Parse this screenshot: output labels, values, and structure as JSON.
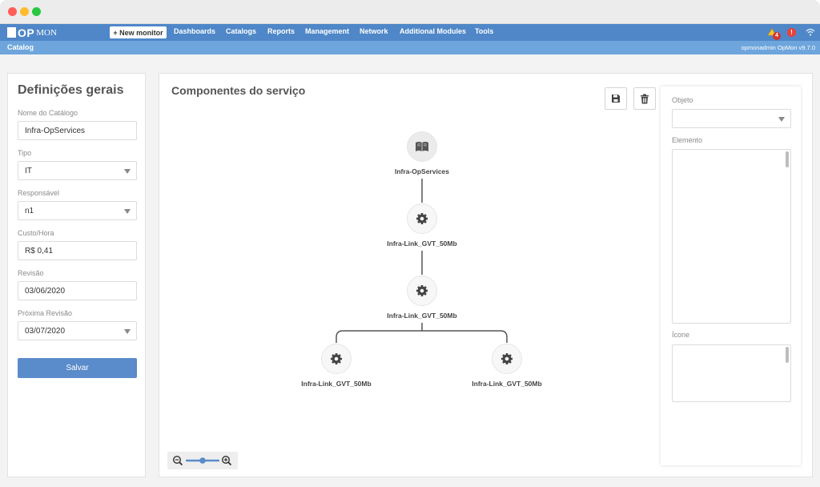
{
  "navbar": {
    "logo_op": "OP",
    "logo_mon": "MON",
    "new_monitor": "+ New monitor",
    "items": [
      "Dashboards",
      "Catalogs",
      "Reports",
      "Management",
      "Network",
      "Additional Modules",
      "Tools"
    ],
    "notification_count": "4"
  },
  "subbar": {
    "breadcrumb": "Catalog",
    "user_info": "opmonadmin  OpMon v9.7.0"
  },
  "left_panel": {
    "title": "Definições gerais",
    "fields": [
      {
        "label": "Nome do Catálogo",
        "value": "Infra-OpServices",
        "type": "text"
      },
      {
        "label": "Tipo",
        "value": "IT",
        "type": "select"
      },
      {
        "label": "Responsável",
        "value": "n1",
        "type": "select"
      },
      {
        "label": "Custo/Hora",
        "value": "R$ 0,41",
        "type": "text"
      },
      {
        "label": "Revisão",
        "value": "03/06/2020",
        "type": "text"
      },
      {
        "label": "Próxima Revisão",
        "value": "03/07/2020",
        "type": "select"
      }
    ],
    "save_label": "Salvar"
  },
  "main_panel": {
    "title": "Componentes do serviço",
    "graph": {
      "root": {
        "label": "Infra-OpServices",
        "icon": "book-icon"
      },
      "nodes": [
        {
          "label": "Infra-Link_GVT_50Mb",
          "icon": "gear-icon"
        },
        {
          "label": "Infra-Link_GVT_50Mb",
          "icon": "gear-icon"
        },
        {
          "label": "Infra-Link_GVT_50Mb",
          "icon": "gear-icon"
        },
        {
          "label": "Infra-Link_GVT_50Mb",
          "icon": "gear-icon"
        }
      ]
    },
    "zoom_level": 0.5
  },
  "right_panel": {
    "objeto_label": "Objeto",
    "elemento_label": "Elemento",
    "icone_label": "Ícone"
  },
  "colors": {
    "navbar": "#4f87c8",
    "subbar": "#6ea5dc",
    "primary_button": "#5a8bca"
  }
}
